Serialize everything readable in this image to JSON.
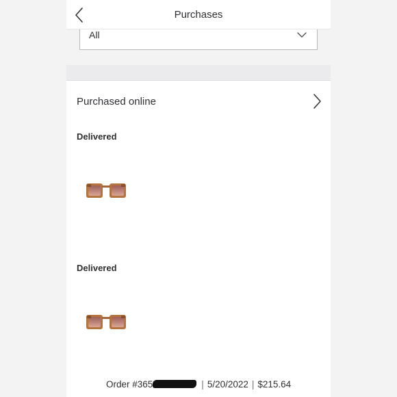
{
  "header": {
    "title": "Purchases"
  },
  "filter": {
    "selected": "All"
  },
  "section": {
    "label": "Purchased online"
  },
  "items": [
    {
      "status": "Delivered",
      "product_icon": "sunglasses-icon"
    },
    {
      "status": "Delivered",
      "product_icon": "sunglasses-icon"
    }
  ],
  "order": {
    "prefix": "Order #365",
    "date": "5/20/2022",
    "total": "$215.64",
    "separator": "|"
  },
  "colors": {
    "frame_tortoise": "#b5733d",
    "lens_tint": "#b88076",
    "text": "#2e2f32",
    "background": "#f3f3f4"
  }
}
